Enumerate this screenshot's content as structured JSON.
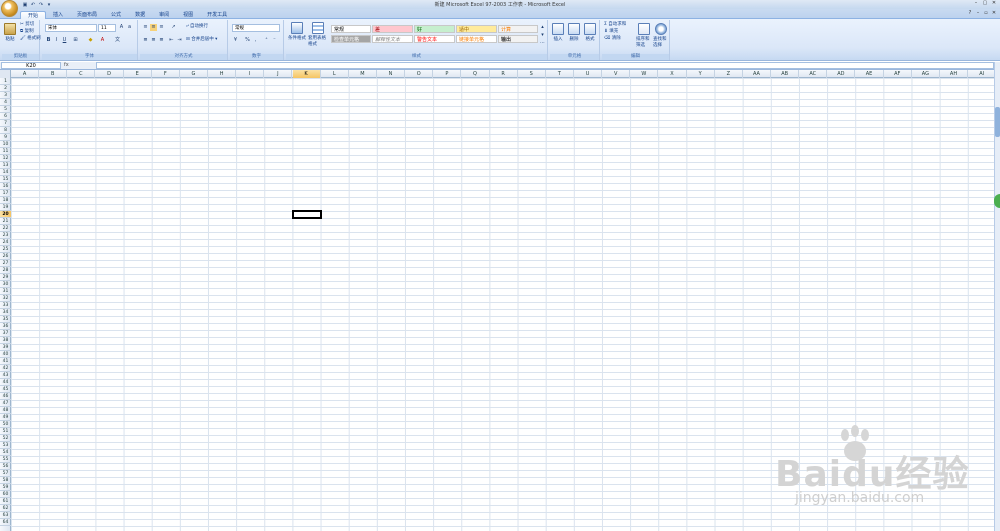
{
  "window": {
    "title": "新建 Microsoft Excel 97-2003 工作表 - Microsoft Excel"
  },
  "tabs": [
    "开始",
    "插入",
    "页面布局",
    "公式",
    "数据",
    "审阅",
    "视图",
    "开发工具"
  ],
  "ribbon": {
    "clipboard": {
      "label": "剪贴板",
      "paste": "粘贴",
      "cut": "剪切",
      "copy": "复制",
      "format_painter": "格式刷"
    },
    "font": {
      "label": "字体",
      "font_name": "宋体",
      "font_size": "11"
    },
    "alignment": {
      "label": "对齐方式",
      "wrap": "自动换行",
      "merge": "合并后居中"
    },
    "number": {
      "label": "数字",
      "format": "常规"
    },
    "styles": {
      "label": "样式",
      "conditional": "条件格式",
      "table": "套用表格格式",
      "cells": [
        "常规",
        "差",
        "好",
        "适中",
        "计算",
        "检查单元格",
        "解释性文本",
        "警告文本",
        "链接单元格",
        "输出"
      ]
    },
    "cells": {
      "label": "单元格",
      "insert": "插入",
      "delete": "删除",
      "format": "格式"
    },
    "editing": {
      "label": "编辑",
      "autosum": "自动求和",
      "fill": "填充",
      "clear": "清除",
      "sort": "排序和筛选",
      "find": "查找和选择"
    }
  },
  "formula_bar": {
    "name_box": "K20",
    "fx": "fx",
    "value": ""
  },
  "sheet": {
    "columns": [
      "A",
      "B",
      "C",
      "D",
      "E",
      "F",
      "G",
      "H",
      "I",
      "J",
      "K",
      "L",
      "M",
      "N",
      "O",
      "P",
      "Q",
      "R",
      "S",
      "T",
      "U",
      "V",
      "W",
      "X",
      "Y",
      "Z",
      "AA",
      "AB",
      "AC",
      "AD",
      "AE",
      "AF",
      "AG",
      "AH",
      "AI"
    ],
    "row_count": 64,
    "selected_column": "K",
    "selected_row": 20
  },
  "watermark": {
    "brand": "Baidu经验",
    "url": "jingyan.baidu.com"
  },
  "colors": {
    "accent": "#f5c463",
    "ribbon": "#dbe7f8",
    "grid": "#dae3ee"
  }
}
